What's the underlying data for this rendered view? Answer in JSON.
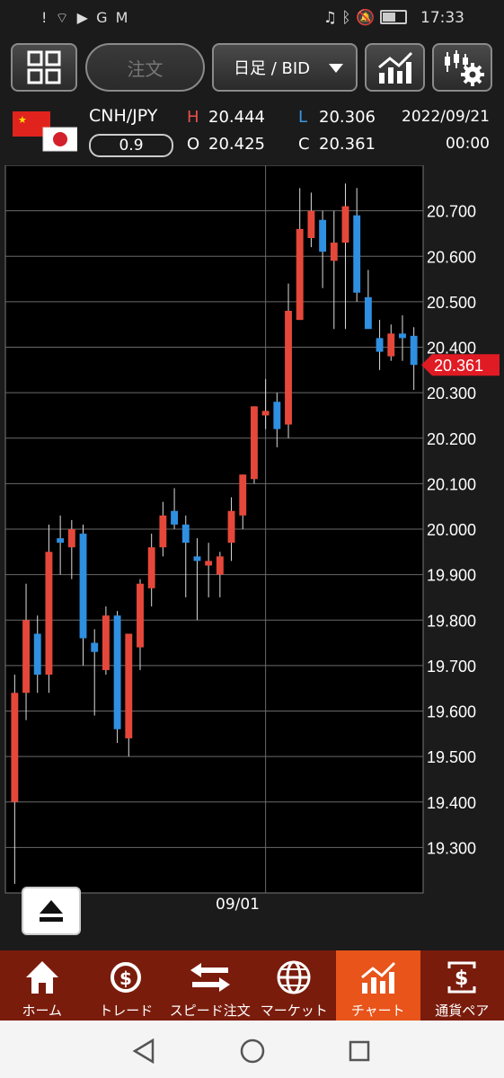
{
  "status_bar": {
    "left_icons": [
      "alert-icon",
      "wifi-icon",
      "youtube-icon",
      "g-icon",
      "gmail-icon"
    ],
    "right_icons": [
      "headset-icon",
      "bluetooth-icon",
      "mute-icon",
      "battery-icon"
    ],
    "time": "17:33"
  },
  "toolbar": {
    "order_label": "注文",
    "timeframe_label": "日足 / BID"
  },
  "quote": {
    "pair": "CNH/JPY",
    "spread": "0.9",
    "high_label": "H",
    "high": "20.444",
    "low_label": "L",
    "low": "20.306",
    "open_label": "O",
    "open": "20.425",
    "close_label": "C",
    "close": "20.361",
    "date": "2022/09/21",
    "time": "00:00"
  },
  "colors": {
    "up": "#e5483a",
    "down": "#2f8fe0",
    "price_tag": "#e01b24",
    "nav_bg": "#7a1c0c",
    "nav_active": "#e8541a"
  },
  "chart_data": {
    "type": "candlestick",
    "ylim": [
      19.2,
      20.8
    ],
    "y_ticks": [
      "20.700",
      "20.600",
      "20.500",
      "20.400",
      "20.300",
      "20.200",
      "20.100",
      "20.000",
      "19.900",
      "19.800",
      "19.700",
      "19.600",
      "19.500",
      "19.400",
      "19.300"
    ],
    "x_tick_label": "09/01",
    "x_tick_index": 22,
    "current_price": "20.361",
    "candles": [
      {
        "o": 19.4,
        "h": 19.68,
        "l": 19.22,
        "c": 19.64
      },
      {
        "o": 19.64,
        "h": 19.88,
        "l": 19.58,
        "c": 19.8
      },
      {
        "o": 19.77,
        "h": 19.81,
        "l": 19.64,
        "c": 19.68
      },
      {
        "o": 19.68,
        "h": 20.01,
        "l": 19.64,
        "c": 19.95
      },
      {
        "o": 19.98,
        "h": 20.03,
        "l": 19.9,
        "c": 19.97
      },
      {
        "o": 19.96,
        "h": 20.02,
        "l": 19.89,
        "c": 20.0
      },
      {
        "o": 19.99,
        "h": 20.01,
        "l": 19.7,
        "c": 19.76
      },
      {
        "o": 19.75,
        "h": 19.78,
        "l": 19.59,
        "c": 19.73
      },
      {
        "o": 19.69,
        "h": 19.83,
        "l": 19.68,
        "c": 19.81
      },
      {
        "o": 19.81,
        "h": 19.82,
        "l": 19.53,
        "c": 19.56
      },
      {
        "o": 19.54,
        "h": 19.77,
        "l": 19.5,
        "c": 19.77
      },
      {
        "o": 19.74,
        "h": 19.89,
        "l": 19.69,
        "c": 19.88
      },
      {
        "o": 19.87,
        "h": 19.99,
        "l": 19.83,
        "c": 19.96
      },
      {
        "o": 19.96,
        "h": 20.06,
        "l": 19.94,
        "c": 20.03
      },
      {
        "o": 20.04,
        "h": 20.09,
        "l": 20.0,
        "c": 20.01
      },
      {
        "o": 20.01,
        "h": 20.03,
        "l": 19.85,
        "c": 19.97
      },
      {
        "o": 19.94,
        "h": 19.98,
        "l": 19.8,
        "c": 19.93
      },
      {
        "o": 19.92,
        "h": 19.97,
        "l": 19.85,
        "c": 19.93
      },
      {
        "o": 19.9,
        "h": 19.95,
        "l": 19.85,
        "c": 19.94
      },
      {
        "o": 19.97,
        "h": 20.07,
        "l": 19.93,
        "c": 20.04
      },
      {
        "o": 20.03,
        "h": 20.12,
        "l": 20.0,
        "c": 20.12
      },
      {
        "o": 20.11,
        "h": 20.27,
        "l": 20.1,
        "c": 20.27
      },
      {
        "o": 20.25,
        "h": 20.33,
        "l": 20.22,
        "c": 20.26
      },
      {
        "o": 20.28,
        "h": 20.3,
        "l": 20.18,
        "c": 20.22
      },
      {
        "o": 20.23,
        "h": 20.54,
        "l": 20.2,
        "c": 20.48
      },
      {
        "o": 20.46,
        "h": 20.75,
        "l": 20.46,
        "c": 20.66
      },
      {
        "o": 20.64,
        "h": 20.74,
        "l": 20.62,
        "c": 20.7
      },
      {
        "o": 20.68,
        "h": 20.7,
        "l": 20.53,
        "c": 20.61
      },
      {
        "o": 20.59,
        "h": 20.7,
        "l": 20.44,
        "c": 20.63
      },
      {
        "o": 20.63,
        "h": 20.76,
        "l": 20.44,
        "c": 20.71
      },
      {
        "o": 20.69,
        "h": 20.75,
        "l": 20.5,
        "c": 20.52
      },
      {
        "o": 20.51,
        "h": 20.57,
        "l": 20.46,
        "c": 20.44
      },
      {
        "o": 20.42,
        "h": 20.46,
        "l": 20.35,
        "c": 20.39
      },
      {
        "o": 20.38,
        "h": 20.45,
        "l": 20.37,
        "c": 20.43
      },
      {
        "o": 20.43,
        "h": 20.47,
        "l": 20.37,
        "c": 20.42
      },
      {
        "o": 20.425,
        "h": 20.444,
        "l": 20.306,
        "c": 20.361
      }
    ]
  },
  "nav": {
    "items": [
      {
        "label": "ホーム",
        "icon": "home-icon"
      },
      {
        "label": "トレード",
        "icon": "trade-icon"
      },
      {
        "label": "スピード注文",
        "icon": "speed-order-icon"
      },
      {
        "label": "マーケット",
        "icon": "market-globe-icon"
      },
      {
        "label": "チャート",
        "icon": "chart-icon"
      },
      {
        "label": "通貨ペア",
        "icon": "currency-pair-icon"
      }
    ],
    "active": 4
  }
}
